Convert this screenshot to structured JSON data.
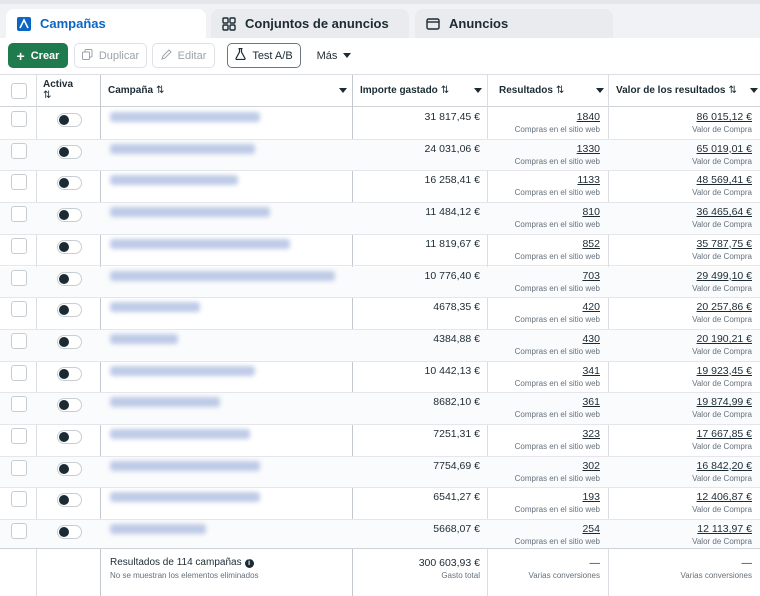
{
  "tabs": [
    {
      "label": "Campañas",
      "icon": "campaigns-icon"
    },
    {
      "label": "Conjuntos de anuncios",
      "icon": "grid-icon"
    },
    {
      "label": "Anuncios",
      "icon": "ad-window-icon"
    }
  ],
  "toolbar": {
    "create": "Crear",
    "duplicate": "Duplicar",
    "edit": "Editar",
    "ab_test": "Test A/B",
    "more": "Más"
  },
  "headers": {
    "active": "Activa",
    "campaign": "Campaña",
    "spend": "Importe gastado",
    "results": "Resultados",
    "value": "Valor de los resultados"
  },
  "rows": [
    {
      "spend": "31 817,45 €",
      "results": "1840",
      "results_label": "Compras en el sitio web",
      "value": "86 015,12 €",
      "value_label": "Valor de Compra"
    },
    {
      "spend": "24 031,06 €",
      "results": "1330",
      "results_label": "Compras en el sitio web",
      "value": "65 019,01 €",
      "value_label": "Valor de Compra"
    },
    {
      "spend": "16 258,41 €",
      "results": "1133",
      "results_label": "Compras en el sitio web",
      "value": "48 569,41 €",
      "value_label": "Valor de Compra"
    },
    {
      "spend": "11 484,12 €",
      "results": "810",
      "results_label": "Compras en el sitio web",
      "value": "36 465,64 €",
      "value_label": "Valor de Compra"
    },
    {
      "spend": "11 819,67 €",
      "results": "852",
      "results_label": "Compras en el sitio web",
      "value": "35 787,75 €",
      "value_label": "Valor de Compra"
    },
    {
      "spend": "10 776,40 €",
      "results": "703",
      "results_label": "Compras en el sitio web",
      "value": "29 499,10 €",
      "value_label": "Valor de Compra"
    },
    {
      "spend": "4678,35 €",
      "results": "420",
      "results_label": "Compras en el sitio web",
      "value": "20 257,86 €",
      "value_label": "Valor de Compra"
    },
    {
      "spend": "4384,88 €",
      "results": "430",
      "results_label": "Compras en el sitio web",
      "value": "20 190,21 €",
      "value_label": "Valor de Compra"
    },
    {
      "spend": "10 442,13 €",
      "results": "341",
      "results_label": "Compras en el sitio web",
      "value": "19 923,45 €",
      "value_label": "Valor de Compra"
    },
    {
      "spend": "8682,10 €",
      "results": "361",
      "results_label": "Compras en el sitio web",
      "value": "19 874,99 €",
      "value_label": "Valor de Compra"
    },
    {
      "spend": "7251,31 €",
      "results": "323",
      "results_label": "Compras en el sitio web",
      "value": "17 667,85 €",
      "value_label": "Valor de Compra"
    },
    {
      "spend": "7754,69 €",
      "results": "302",
      "results_label": "Compras en el sitio web",
      "value": "16 842,20 €",
      "value_label": "Valor de Compra"
    },
    {
      "spend": "6541,27 €",
      "results": "193",
      "results_label": "Compras en el sitio web",
      "value": "12 406,87 €",
      "value_label": "Valor de Compra"
    },
    {
      "spend": "5668,07 €",
      "results": "254",
      "results_label": "Compras en el sitio web",
      "value": "12 113,97 €",
      "value_label": "Valor de Compra"
    }
  ],
  "footer": {
    "summary": "Resultados de 114 campañas",
    "note": "No se muestran los elementos eliminados",
    "total_spend": "300 603,93 €",
    "total_spend_label": "Gasto total",
    "results_dash": "—",
    "results_label": "Varias conversiones",
    "value_dash": "—",
    "value_label": "Varias conversiones"
  },
  "colors": {
    "accent": "#0a66c2",
    "create_button": "#1f7a4d"
  }
}
